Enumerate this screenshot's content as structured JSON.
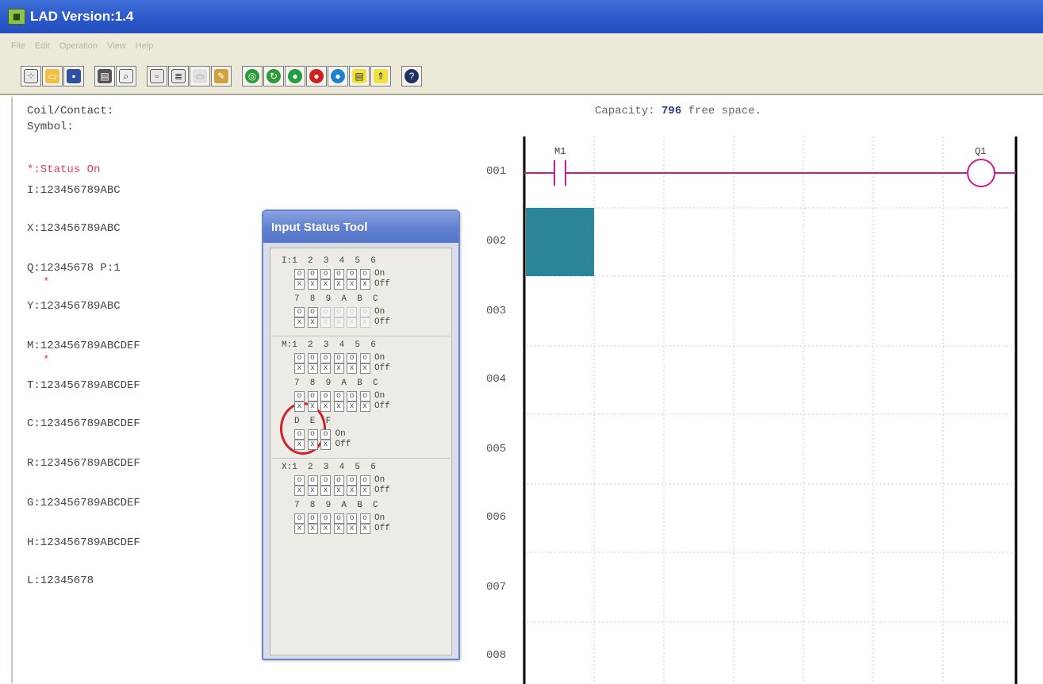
{
  "window": {
    "title": "LAD Version:1.4"
  },
  "menu": [
    "File",
    "Edit",
    "Operation",
    "View",
    "Help"
  ],
  "toolbar": {
    "icons": [
      "new-file-icon",
      "open-folder-icon",
      "save-icon",
      "print-icon",
      "print-preview-icon",
      "monitor-icon",
      "list-icon",
      "disabled-icon",
      "write-icon",
      "run-icon",
      "refresh-icon",
      "green-ball-icon",
      "red-ball-icon",
      "blue-ball-icon",
      "note-icon",
      "note-up-icon",
      "help-icon"
    ]
  },
  "sidebar": {
    "coil_contact_label": "Coil/Contact:",
    "symbol_label": "Symbol:",
    "status_on": "*:Status On",
    "rows": [
      {
        "text": "I:123456789ABC"
      },
      {
        "text": "X:123456789ABC"
      },
      {
        "text": "Q:12345678 P:1"
      },
      {
        "text": "Y:123456789ABC"
      },
      {
        "text": "M:123456789ABCDEF"
      },
      {
        "text": "T:123456789ABCDEF"
      },
      {
        "text": "C:123456789ABCDEF"
      },
      {
        "text": "R:123456789ABCDEF"
      },
      {
        "text": "G:123456789ABCDEF"
      },
      {
        "text": "H:123456789ABCDEF"
      },
      {
        "text": "L:12345678"
      }
    ],
    "star": "*"
  },
  "capacity": {
    "prefix": "Capacity:",
    "value": "796",
    "suffix": "free space."
  },
  "ladder": {
    "rungs": [
      "001",
      "002",
      "003",
      "004",
      "005",
      "006",
      "007",
      "008"
    ],
    "contact_label": "M1",
    "coil_label": "Q1",
    "colors": {
      "line": "#d21a8c",
      "cursor": "#2b8599",
      "rail": "#000000"
    }
  },
  "dialog": {
    "title": "Input Status Tool",
    "on_label": "On",
    "off_label": "Off",
    "on_mark": "o",
    "off_mark": "x",
    "groups": [
      {
        "prefix": "I:",
        "rows": [
          {
            "header": "1  2  3  4  5  6",
            "count": 6,
            "disabled": []
          },
          {
            "header": "7  8  9  A  B  C",
            "count": 6,
            "disabled": [
              2,
              3,
              4,
              5
            ]
          }
        ]
      },
      {
        "prefix": "M:",
        "rows": [
          {
            "header": "1  2  3  4  5  6",
            "count": 6,
            "disabled": []
          },
          {
            "header": "7  8  9  A  B  C",
            "count": 6,
            "disabled": []
          },
          {
            "header": "D  E  F",
            "count": 3,
            "disabled": []
          }
        ]
      },
      {
        "prefix": "X:",
        "rows": [
          {
            "header": "1  2  3  4  5  6",
            "count": 6,
            "disabled": []
          },
          {
            "header": "7  8  9  A  B  C",
            "count": 6,
            "disabled": []
          }
        ]
      }
    ]
  }
}
